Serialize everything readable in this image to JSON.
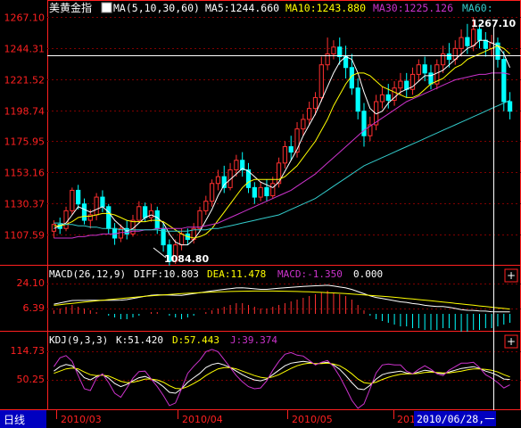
{
  "header": {
    "title": "美黄金指",
    "ma_label": "MA(5,10,30,60)",
    "ma5": "MA5:1244.660",
    "ma10": "MA10:1243.880",
    "ma30": "MA30:1225.126",
    "ma60": "MA60:"
  },
  "main_axis": {
    "ticks": [
      "1267.10",
      "1244.31",
      "1221.52",
      "1198.74",
      "1175.95",
      "1153.16",
      "1130.37",
      "1107.59"
    ]
  },
  "annotations": {
    "high": "1267.10",
    "low": "1084.80"
  },
  "macd": {
    "label": "MACD(26,12,9)",
    "diff": "DIFF:10.803",
    "dea": "DEA:11.478",
    "macd_val": "MACD:-1.350",
    "extra": "0.000",
    "ticks": [
      "24.10",
      "6.39"
    ]
  },
  "kdj": {
    "label": "KDJ(9,3,3)",
    "k": "K:51.420",
    "d": "D:57.443",
    "j": "J:39.374",
    "ticks": [
      "114.73",
      "50.25"
    ]
  },
  "footer": {
    "period": "日线",
    "dates": [
      "2010/03",
      "2010/04",
      "2010/05"
    ],
    "date_partial": "201",
    "cursor_date": "2010/06/28,一"
  },
  "colors": {
    "up": "#ff3030",
    "down": "#00ffff",
    "ma5": "#ffffff",
    "ma10": "#ffff00",
    "ma30": "#cc33cc",
    "ma60": "#33cccc",
    "grid": "#800000",
    "axis": "#ff2020"
  },
  "chart_data": {
    "type": "candlestick",
    "price_range": [
      1084.8,
      1267.1
    ],
    "candles": [
      [
        1110,
        1115,
        1105,
        1118
      ],
      [
        1115,
        1112,
        1108,
        1120
      ],
      [
        1112,
        1125,
        1110,
        1128
      ],
      [
        1125,
        1140,
        1122,
        1142
      ],
      [
        1140,
        1130,
        1126,
        1144
      ],
      [
        1130,
        1118,
        1115,
        1134
      ],
      [
        1118,
        1122,
        1112,
        1126
      ],
      [
        1122,
        1135,
        1118,
        1138
      ],
      [
        1135,
        1128,
        1124,
        1140
      ],
      [
        1128,
        1112,
        1108,
        1130
      ],
      [
        1112,
        1105,
        1100,
        1116
      ],
      [
        1105,
        1112,
        1102,
        1115
      ],
      [
        1112,
        1108,
        1104,
        1118
      ],
      [
        1108,
        1118,
        1106,
        1122
      ],
      [
        1118,
        1128,
        1116,
        1132
      ],
      [
        1128,
        1120,
        1117,
        1131
      ],
      [
        1120,
        1125,
        1117,
        1130
      ],
      [
        1125,
        1112,
        1108,
        1128
      ],
      [
        1112,
        1100,
        1095,
        1116
      ],
      [
        1100,
        1088,
        1084.8,
        1104
      ],
      [
        1088,
        1100,
        1086,
        1104
      ],
      [
        1100,
        1108,
        1096,
        1112
      ],
      [
        1108,
        1104,
        1100,
        1112
      ],
      [
        1104,
        1112,
        1101,
        1116
      ],
      [
        1112,
        1125,
        1110,
        1128
      ],
      [
        1125,
        1132,
        1122,
        1136
      ],
      [
        1132,
        1145,
        1128,
        1148
      ],
      [
        1145,
        1150,
        1140,
        1155
      ],
      [
        1150,
        1142,
        1138,
        1158
      ],
      [
        1142,
        1155,
        1140,
        1160
      ],
      [
        1155,
        1162,
        1150,
        1166
      ],
      [
        1162,
        1155,
        1150,
        1168
      ],
      [
        1155,
        1142,
        1138,
        1160
      ],
      [
        1142,
        1135,
        1130,
        1146
      ],
      [
        1135,
        1142,
        1132,
        1146
      ],
      [
        1142,
        1136,
        1132,
        1148
      ],
      [
        1136,
        1145,
        1134,
        1150
      ],
      [
        1145,
        1160,
        1142,
        1164
      ],
      [
        1160,
        1172,
        1156,
        1176
      ],
      [
        1172,
        1168,
        1162,
        1180
      ],
      [
        1168,
        1185,
        1164,
        1190
      ],
      [
        1185,
        1192,
        1180,
        1196
      ],
      [
        1192,
        1200,
        1188,
        1205
      ],
      [
        1200,
        1208,
        1195,
        1212
      ],
      [
        1208,
        1232,
        1205,
        1238
      ],
      [
        1232,
        1240,
        1228,
        1252
      ],
      [
        1240,
        1245,
        1236,
        1250
      ],
      [
        1245,
        1238,
        1232,
        1252
      ],
      [
        1238,
        1230,
        1222,
        1246
      ],
      [
        1230,
        1215,
        1210,
        1240
      ],
      [
        1215,
        1198,
        1192,
        1222
      ],
      [
        1198,
        1180,
        1172,
        1204
      ],
      [
        1180,
        1188,
        1176,
        1194
      ],
      [
        1188,
        1205,
        1184,
        1210
      ],
      [
        1205,
        1210,
        1200,
        1216
      ],
      [
        1210,
        1206,
        1200,
        1218
      ],
      [
        1206,
        1215,
        1202,
        1220
      ],
      [
        1215,
        1220,
        1210,
        1226
      ],
      [
        1220,
        1214,
        1208,
        1226
      ],
      [
        1214,
        1225,
        1210,
        1230
      ],
      [
        1225,
        1232,
        1220,
        1236
      ],
      [
        1232,
        1226,
        1220,
        1238
      ],
      [
        1226,
        1218,
        1214,
        1232
      ],
      [
        1218,
        1232,
        1214,
        1236
      ],
      [
        1232,
        1240,
        1226,
        1246
      ],
      [
        1240,
        1236,
        1230,
        1248
      ],
      [
        1236,
        1244,
        1232,
        1250
      ],
      [
        1244,
        1252,
        1238,
        1258
      ],
      [
        1252,
        1246,
        1240,
        1262
      ],
      [
        1246,
        1258,
        1242,
        1267.1
      ],
      [
        1258,
        1250,
        1244,
        1262
      ],
      [
        1250,
        1244,
        1238,
        1256
      ],
      [
        1244,
        1248,
        1238,
        1254
      ],
      [
        1248,
        1236,
        1230,
        1252
      ],
      [
        1236,
        1205,
        1198,
        1242
      ],
      [
        1205,
        1198,
        1192,
        1212
      ]
    ],
    "series": [
      {
        "name": "MA5",
        "values": [
          1112,
          1114,
          1116,
          1122,
          1128,
          1126,
          1124,
          1126,
          1128,
          1124,
          1118,
          1114,
          1110,
          1112,
          1116,
          1120,
          1122,
          1120,
          1116,
          1108,
          1102,
          1100,
          1100,
          1104,
          1110,
          1118,
          1126,
          1136,
          1144,
          1148,
          1152,
          1156,
          1154,
          1150,
          1146,
          1144,
          1142,
          1146,
          1154,
          1162,
          1170,
          1180,
          1188,
          1196,
          1206,
          1216,
          1226,
          1234,
          1238,
          1236,
          1226,
          1212,
          1200,
          1196,
          1198,
          1204,
          1208,
          1212,
          1214,
          1216,
          1220,
          1224,
          1224,
          1226,
          1228,
          1232,
          1236,
          1240,
          1244,
          1246,
          1250,
          1250,
          1248,
          1246,
          1240,
          1230
        ]
      },
      {
        "name": "MA10",
        "values": [
          1114,
          1114,
          1115,
          1117,
          1120,
          1121,
          1121,
          1122,
          1123,
          1123,
          1122,
          1120,
          1118,
          1117,
          1117,
          1117,
          1118,
          1118,
          1117,
          1114,
          1111,
          1108,
          1106,
          1105,
          1106,
          1108,
          1112,
          1118,
          1124,
          1130,
          1136,
          1142,
          1146,
          1148,
          1148,
          1148,
          1148,
          1148,
          1150,
          1154,
          1158,
          1164,
          1170,
          1176,
          1184,
          1192,
          1202,
          1210,
          1218,
          1224,
          1226,
          1226,
          1224,
          1220,
          1216,
          1214,
          1212,
          1210,
          1208,
          1208,
          1210,
          1214,
          1218,
          1220,
          1222,
          1226,
          1230,
          1232,
          1236,
          1238,
          1240,
          1242,
          1244,
          1246,
          1244,
          1240
        ]
      },
      {
        "name": "MA30",
        "values": [
          1105,
          1105,
          1105,
          1105,
          1106,
          1106,
          1107,
          1107,
          1108,
          1108,
          1108,
          1109,
          1109,
          1110,
          1110,
          1111,
          1111,
          1112,
          1112,
          1112,
          1112,
          1112,
          1113,
          1113,
          1113,
          1114,
          1115,
          1116,
          1118,
          1120,
          1122,
          1124,
          1126,
          1128,
          1130,
          1132,
          1134,
          1136,
          1138,
          1140,
          1143,
          1146,
          1149,
          1152,
          1156,
          1160,
          1164,
          1168,
          1172,
          1176,
          1180,
          1184,
          1187,
          1190,
          1193,
          1196,
          1199,
          1202,
          1205,
          1207,
          1209,
          1211,
          1213,
          1215,
          1217,
          1219,
          1221,
          1222,
          1223,
          1224,
          1225,
          1225,
          1226,
          1226,
          1226,
          1225
        ]
      },
      {
        "name": "MA60",
        "values": [
          1116,
          1116,
          1115,
          1115,
          1114,
          1114,
          1113,
          1113,
          1112,
          1112,
          1112,
          1111,
          1111,
          1111,
          1111,
          1111,
          1111,
          1111,
          1110,
          1110,
          1110,
          1110,
          1110,
          1111,
          1111,
          1111,
          1112,
          1112,
          1113,
          1114,
          1115,
          1116,
          1117,
          1118,
          1119,
          1120,
          1121,
          1122,
          1124,
          1126,
          1128,
          1130,
          1132,
          1134,
          1137,
          1140,
          1143,
          1146,
          1149,
          1152,
          1155,
          1158,
          1160,
          1162,
          1164,
          1166,
          1168,
          1170,
          1172,
          1174,
          1176,
          1178,
          1180,
          1182,
          1184,
          1186,
          1188,
          1190,
          1192,
          1194,
          1196,
          1198,
          1200,
          1202,
          1204,
          1206
        ]
      }
    ],
    "macd_hist": [
      2,
      3,
      4,
      5,
      4,
      3,
      2,
      1,
      0,
      -1,
      -2,
      -3,
      -3,
      -2,
      -1,
      0,
      1,
      1,
      0,
      -1,
      -2,
      -3,
      -2,
      -1,
      0,
      1,
      2,
      3,
      4,
      5,
      6,
      6,
      5,
      4,
      3,
      3,
      4,
      5,
      6,
      7,
      8,
      9,
      10,
      11,
      12,
      13,
      12,
      11,
      10,
      8,
      5,
      2,
      -1,
      -3,
      -4,
      -5,
      -6,
      -7,
      -7,
      -8,
      -8,
      -9,
      -9,
      -9,
      -8,
      -8,
      -9,
      -10,
      -10,
      -9,
      -9,
      -8,
      -8,
      -7,
      -6,
      -5
    ],
    "kdj_k": [
      70,
      80,
      85,
      82,
      70,
      55,
      50,
      58,
      62,
      54,
      42,
      35,
      40,
      48,
      55,
      58,
      52,
      45,
      35,
      22,
      20,
      30,
      45,
      55,
      65,
      78,
      85,
      88,
      84,
      78,
      70,
      62,
      55,
      50,
      48,
      52,
      62,
      72,
      82,
      88,
      90,
      92,
      90,
      86,
      88,
      90,
      84,
      74,
      60,
      44,
      30,
      28,
      38,
      52,
      62,
      66,
      68,
      70,
      66,
      64,
      68,
      72,
      70,
      66,
      64,
      68,
      72,
      76,
      78,
      80,
      76,
      70,
      66,
      60,
      52,
      51
    ],
    "kdj_d": [
      65,
      70,
      75,
      77,
      75,
      68,
      62,
      60,
      61,
      59,
      53,
      47,
      44,
      45,
      48,
      52,
      52,
      50,
      45,
      37,
      31,
      30,
      35,
      42,
      50,
      60,
      68,
      75,
      78,
      78,
      75,
      70,
      65,
      60,
      56,
      54,
      57,
      62,
      69,
      76,
      82,
      86,
      88,
      87,
      87,
      88,
      86,
      82,
      74,
      64,
      52,
      44,
      42,
      45,
      51,
      56,
      60,
      63,
      64,
      64,
      65,
      67,
      68,
      67,
      66,
      66,
      68,
      70,
      73,
      75,
      75,
      74,
      72,
      68,
      62,
      57
    ],
    "kdj_j": [
      80,
      100,
      105,
      92,
      60,
      30,
      26,
      54,
      64,
      44,
      20,
      11,
      32,
      54,
      69,
      70,
      52,
      35,
      15,
      -8,
      -2,
      30,
      65,
      81,
      95,
      114,
      119,
      114,
      96,
      78,
      60,
      46,
      35,
      30,
      32,
      48,
      72,
      92,
      108,
      112,
      106,
      104,
      94,
      84,
      90,
      94,
      80,
      58,
      32,
      4,
      -14,
      -4,
      30,
      66,
      84,
      86,
      84,
      84,
      70,
      64,
      74,
      82,
      74,
      64,
      60,
      72,
      80,
      88,
      88,
      90,
      78,
      62,
      54,
      44,
      32,
      39
    ]
  }
}
